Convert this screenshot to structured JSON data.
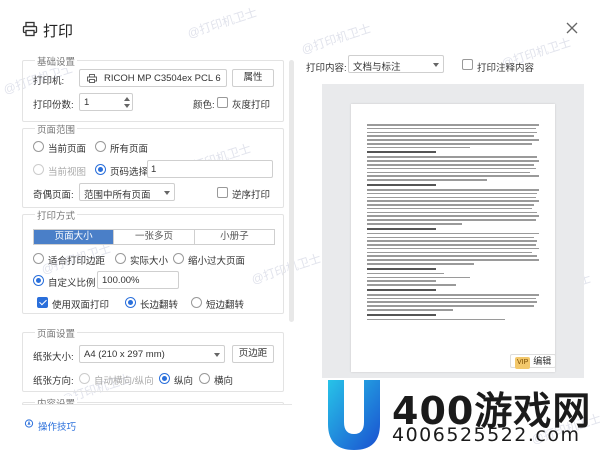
{
  "dialog": {
    "title": "打印"
  },
  "watermark": {
    "text": "@打印机卫士"
  },
  "basic": {
    "title": "基础设置",
    "printer_label": "打印机:",
    "printer_value": "RICOH MP C3504ex PCL 6",
    "props_button": "属性",
    "copies_label": "打印份数:",
    "copies_value": "1",
    "color_label": "颜色:",
    "gray_label": "灰度打印"
  },
  "range": {
    "title": "页面范围",
    "current_page": "当前页面",
    "all_pages": "所有页面",
    "current_view": "当前视图",
    "page_select": "页码选择:",
    "page_select_value": "1",
    "odd_even_label": "奇偶页面:",
    "odd_even_value": "范围中所有页面",
    "reverse_label": "逆序打印"
  },
  "mode": {
    "title": "打印方式",
    "tabs": [
      "页面大小",
      "一张多页",
      "小册子"
    ],
    "fit_margin": "适合打印边距",
    "actual_size": "实际大小",
    "shrink": "缩小过大页面",
    "custom_scale": "自定义比例",
    "scale_value": "100.00%",
    "duplex": "使用双面打印",
    "long_edge": "长边翻转",
    "short_edge": "短边翻转"
  },
  "pagesetup": {
    "title": "页面设置",
    "size_label": "纸张大小:",
    "size_value": "A4 (210 x 297 mm)",
    "margin_button": "页边距",
    "orient_label": "纸张方向:",
    "auto_orient": "自动横向/纵向",
    "portrait": "纵向",
    "landscape": "横向"
  },
  "next_section": {
    "title": "内容设置"
  },
  "footer": {
    "help": "操作技巧"
  },
  "right": {
    "content_label": "打印内容:",
    "content_value": "文档与标注",
    "annot_label": "打印注释内容",
    "vip": "VIP",
    "edit": "编辑"
  },
  "brand": {
    "big": "400游戏网",
    "small": "4006525522.com"
  },
  "colors": {
    "accent": "#2a6fdb",
    "tab_active": "#4a7fc8"
  }
}
